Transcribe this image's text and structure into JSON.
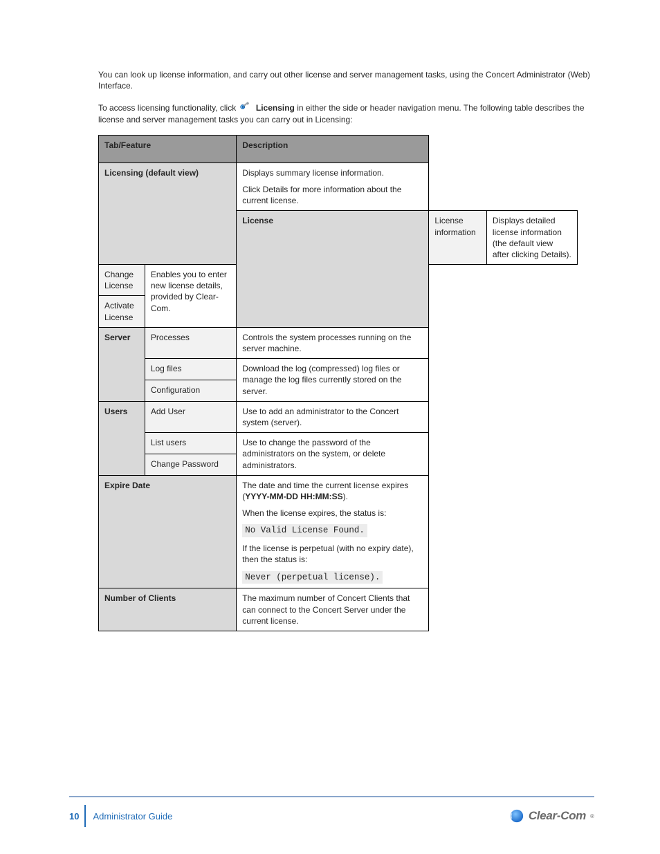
{
  "intro": {
    "p1": "You can look up license information, and carry out other license and server management tasks, using the Concert Administrator (Web) Interface.",
    "p2_prefix": "To access licensing functionality, click ",
    "p2_icon_label": "key-icon",
    "p2_after_icon": " Licensing",
    "p2_suffix": " in either the side or header navigation menu. The following table describes the license and server management tasks you can carry out in Licensing:",
    "intro_bold": true
  },
  "table": {
    "headers": [
      "Tab/Feature",
      "Description"
    ],
    "rows": [
      {
        "cells": [
          {
            "text": "Licensing (default view)",
            "bold": true,
            "shade": "dark",
            "colspan": 2,
            "rowspan": 2
          },
          {
            "paras": [
              "Displays summary license information.",
              "Click Details for more information about the current license."
            ],
            "shade": "white",
            "colspan": 1
          }
        ]
      },
      {
        "cells": [
          {
            "text": "License",
            "bold": true,
            "shade": "dark",
            "rowspan": 3
          },
          {
            "text": "License information",
            "shade": "light"
          },
          {
            "text": "Displays detailed license information (the default view after clicking Details).",
            "shade": "white"
          }
        ]
      },
      {
        "cells": [
          {
            "text": "Change License",
            "shade": "light"
          },
          {
            "paras": [
              "Enables you to enter new license details, provided by Clear-Com."
            ],
            "shade": "white",
            "rowspan": 2
          }
        ]
      },
      {
        "cells": [
          {
            "text": "Activate License",
            "shade": "light"
          }
        ]
      },
      {
        "cells": [
          {
            "text": "Server",
            "bold": true,
            "shade": "dark",
            "rowspan": 3
          },
          {
            "text": "Processes",
            "shade": "light"
          },
          {
            "text": "Controls the system processes running on the server machine.",
            "shade": "white"
          }
        ]
      },
      {
        "cells": [
          {
            "text": "Log files",
            "shade": "light"
          },
          {
            "paras": [
              "Download the log (compressed) log files or manage the log files currently stored on the server."
            ],
            "shade": "white",
            "rowspan": 2
          }
        ]
      },
      {
        "cells": [
          {
            "text": "Configuration",
            "shade": "light"
          }
        ]
      },
      {
        "cells": [
          {
            "text": "Users",
            "bold": true,
            "shade": "dark",
            "rowspan": 3
          },
          {
            "text": "Add User",
            "shade": "light"
          },
          {
            "text": "Use to add an administrator to the Concert system (server).",
            "shade": "white"
          }
        ]
      },
      {
        "cells": [
          {
            "text": "List users",
            "shade": "light"
          },
          {
            "paras": [
              "Use to change the password of the administrators on the system, or delete administrators."
            ],
            "shade": "white",
            "rowspan": 2
          }
        ]
      },
      {
        "cells": [
          {
            "text": "Change Password",
            "shade": "light"
          }
        ]
      }
    ],
    "expire_row": {
      "left": "Expire Date",
      "right": {
        "p1_prefix": "The date and time the current license expires (",
        "p1_bold": "YYYY-MM-DD HH:MM:SS",
        "p1_suffix": ").",
        "p2_text": "When the license expires, the status is:",
        "code1": "No Valid License Found.",
        "p3_text": "If the license is perpetual (with no expiry date), then the status is:",
        "code2": "Never (perpetual license)."
      }
    },
    "clients_row": {
      "left": "Number of Clients",
      "right": "The maximum number of Concert Clients that can connect to the Concert Server under the current license."
    }
  },
  "footer": {
    "page_number": "10",
    "title": "Administrator Guide",
    "brand": "Clear-Com"
  }
}
